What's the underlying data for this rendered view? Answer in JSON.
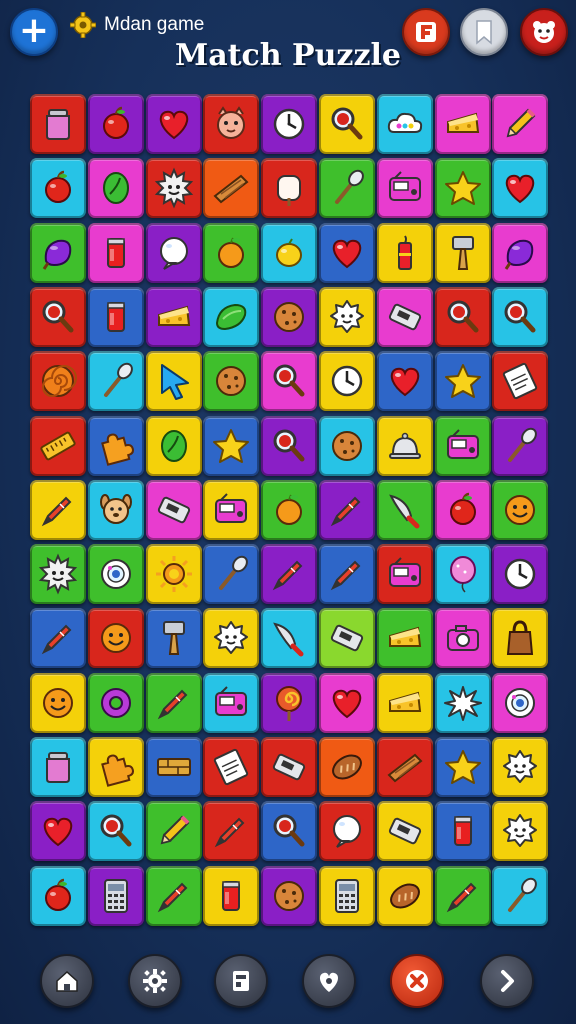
{
  "header": {
    "game_name": "Mdan game",
    "title": "Match Puzzle"
  },
  "colors": {
    "R": "#d8261c",
    "P": "#8a1fc6",
    "Y": "#f4d10a",
    "C": "#27c3e6",
    "G": "#3fbf2c",
    "O": "#f05a14",
    "B": "#2e66c8",
    "M": "#e83ccf",
    "L": "#8ad82e"
  },
  "board": {
    "rows": [
      [
        [
          "R",
          "jar-icon"
        ],
        [
          "P",
          "apple-icon"
        ],
        [
          "P",
          "heart-icon"
        ],
        [
          "R",
          "cat-face-icon"
        ],
        [
          "P",
          "clock-icon"
        ],
        [
          "Y",
          "magnifier-icon"
        ],
        [
          "C",
          "cloud-icon"
        ],
        [
          "M",
          "cheese-icon"
        ],
        [
          "M",
          "pencil-icon"
        ]
      ],
      [
        [
          "C",
          "apple-icon"
        ],
        [
          "M",
          "leaf-icon"
        ],
        [
          "R",
          "sun-face-icon"
        ],
        [
          "O",
          "plank-icon"
        ],
        [
          "R",
          "marshmallow-icon"
        ],
        [
          "G",
          "brush-icon"
        ],
        [
          "M",
          "radio-icon"
        ],
        [
          "G",
          "star-icon"
        ],
        [
          "C",
          "heart-icon"
        ]
      ],
      [
        [
          "G",
          "purple-fruit-icon"
        ],
        [
          "M",
          "can-icon"
        ],
        [
          "P",
          "bubble-icon"
        ],
        [
          "G",
          "orange-icon"
        ],
        [
          "C",
          "lemon-icon"
        ],
        [
          "B",
          "heart-icon"
        ],
        [
          "Y",
          "firecracker-icon"
        ],
        [
          "Y",
          "hammer-icon"
        ],
        [
          "M",
          "purple-fruit-icon"
        ]
      ],
      [
        [
          "R",
          "magnifier-icon"
        ],
        [
          "B",
          "can-icon"
        ],
        [
          "P",
          "cheese-icon"
        ],
        [
          "C",
          "pickle-icon"
        ],
        [
          "P",
          "cookie-icon"
        ],
        [
          "Y",
          "cloud-face-icon"
        ],
        [
          "M",
          "remote-icon"
        ],
        [
          "R",
          "magnifier-icon"
        ],
        [
          "C",
          "magnifier-icon"
        ]
      ],
      [
        [
          "R",
          "spiral-icon"
        ],
        [
          "C",
          "brush-icon"
        ],
        [
          "Y",
          "cursor-icon"
        ],
        [
          "G",
          "cookie-icon"
        ],
        [
          "M",
          "magnifier-icon"
        ],
        [
          "Y",
          "clock-icon"
        ],
        [
          "B",
          "heart-icon"
        ],
        [
          "B",
          "star-icon"
        ],
        [
          "R",
          "receipt-icon"
        ]
      ],
      [
        [
          "R",
          "ruler-icon"
        ],
        [
          "B",
          "puzzle-icon"
        ],
        [
          "Y",
          "leaf-icon"
        ],
        [
          "B",
          "star-icon"
        ],
        [
          "P",
          "magnifier-icon"
        ],
        [
          "C",
          "cookie-icon"
        ],
        [
          "Y",
          "bell-icon"
        ],
        [
          "G",
          "radio-icon"
        ],
        [
          "P",
          "brush-icon"
        ]
      ],
      [
        [
          "Y",
          "crayon-icon"
        ],
        [
          "C",
          "dog-face-icon"
        ],
        [
          "M",
          "remote-icon"
        ],
        [
          "Y",
          "radio-icon"
        ],
        [
          "G",
          "orange-icon"
        ],
        [
          "P",
          "crayon-icon"
        ],
        [
          "G",
          "knife-icon"
        ],
        [
          "M",
          "apple-icon"
        ],
        [
          "G",
          "smiley-icon"
        ]
      ],
      [
        [
          "G",
          "sun-face-icon"
        ],
        [
          "G",
          "target-icon"
        ],
        [
          "Y",
          "sun-icon"
        ],
        [
          "B",
          "brush-icon"
        ],
        [
          "P",
          "crayon-icon"
        ],
        [
          "B",
          "crayon-icon"
        ],
        [
          "R",
          "radio-icon"
        ],
        [
          "C",
          "balloon-icon"
        ],
        [
          "P",
          "clock-icon"
        ]
      ],
      [
        [
          "B",
          "crayon-icon"
        ],
        [
          "R",
          "smiley-icon"
        ],
        [
          "B",
          "hammer-icon"
        ],
        [
          "Y",
          "cloud-face-icon"
        ],
        [
          "C",
          "knife-icon"
        ],
        [
          "L",
          "remote-icon"
        ],
        [
          "G",
          "cheese-icon"
        ],
        [
          "M",
          "camera-icon"
        ],
        [
          "Y",
          "bag-icon"
        ]
      ],
      [
        [
          "Y",
          "smiley-icon"
        ],
        [
          "G",
          "donut-icon"
        ],
        [
          "G",
          "crayon-icon"
        ],
        [
          "C",
          "radio-icon"
        ],
        [
          "P",
          "lollipop-icon"
        ],
        [
          "M",
          "heart-icon"
        ],
        [
          "Y",
          "cheese-icon"
        ],
        [
          "C",
          "splash-icon"
        ],
        [
          "M",
          "target-icon"
        ]
      ],
      [
        [
          "C",
          "jar-icon"
        ],
        [
          "Y",
          "puzzle-icon"
        ],
        [
          "B",
          "brick-icon"
        ],
        [
          "R",
          "receipt-icon"
        ],
        [
          "R",
          "remote-icon"
        ],
        [
          "O",
          "bread-icon"
        ],
        [
          "R",
          "plank-icon"
        ],
        [
          "B",
          "star-icon"
        ],
        [
          "Y",
          "cloud-face-icon"
        ]
      ],
      [
        [
          "P",
          "heart-icon"
        ],
        [
          "C",
          "magnifier-icon"
        ],
        [
          "G",
          "pencil-icon"
        ],
        [
          "R",
          "crayon-icon"
        ],
        [
          "B",
          "magnifier-icon"
        ],
        [
          "R",
          "bubble-icon"
        ],
        [
          "Y",
          "remote-icon"
        ],
        [
          "B",
          "can-icon"
        ],
        [
          "Y",
          "cloud-face-icon"
        ]
      ],
      [
        [
          "C",
          "apple-icon"
        ],
        [
          "P",
          "calculator-icon"
        ],
        [
          "G",
          "crayon-icon"
        ],
        [
          "Y",
          "can-icon"
        ],
        [
          "P",
          "cookie-icon"
        ],
        [
          "Y",
          "calculator-icon"
        ],
        [
          "Y",
          "bread-icon"
        ],
        [
          "G",
          "crayon-icon"
        ],
        [
          "C",
          "brush-icon"
        ]
      ]
    ]
  },
  "nav": [
    {
      "icon": "home-icon"
    },
    {
      "icon": "settings-icon"
    },
    {
      "icon": "puzzle-piece-icon"
    },
    {
      "icon": "heart-badge-icon"
    },
    {
      "icon": "close-icon"
    },
    {
      "icon": "chevron-right-icon"
    }
  ]
}
